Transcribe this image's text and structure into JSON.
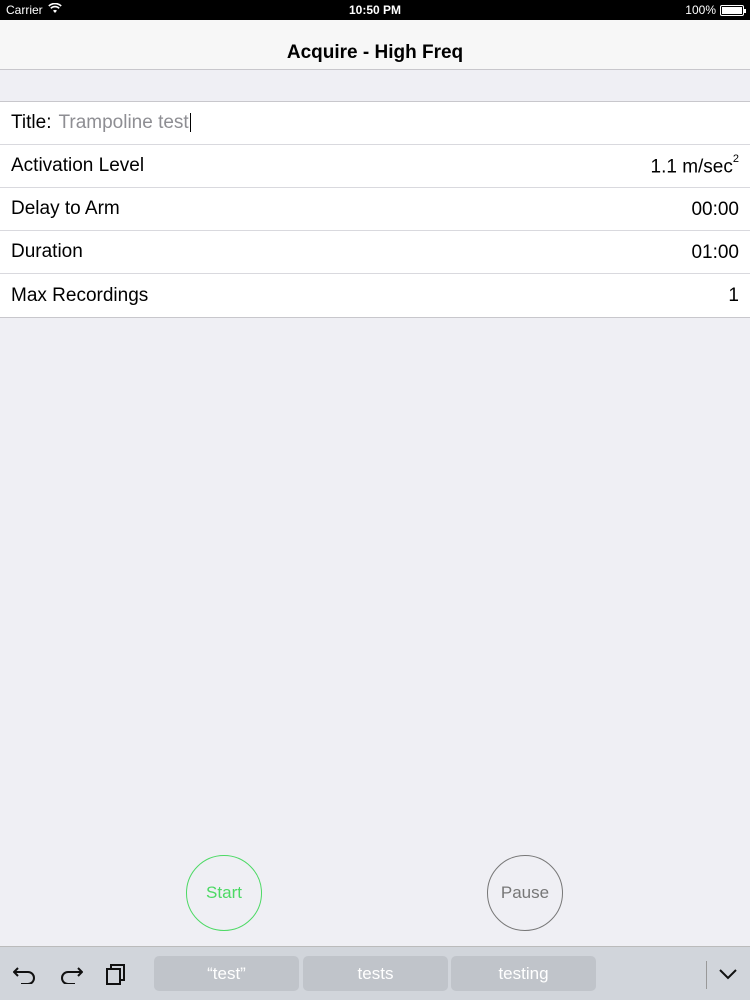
{
  "status_bar": {
    "carrier": "Carrier",
    "time": "10:50 PM",
    "battery": "100%"
  },
  "nav": {
    "title": "Acquire - High Freq"
  },
  "form": {
    "title_label": "Title:",
    "title_value": "Trampoline test",
    "rows": [
      {
        "label": "Activation Level",
        "value": "1.1  m/sec",
        "superscript": "2"
      },
      {
        "label": "Delay to Arm",
        "value": "00:00"
      },
      {
        "label": "Duration",
        "value": "01:00"
      },
      {
        "label": "Max Recordings",
        "value": "1"
      }
    ]
  },
  "buttons": {
    "start": "Start",
    "pause": "Pause"
  },
  "keyboard_bar": {
    "suggestions": [
      "“test”",
      "tests",
      "testing"
    ],
    "icons": [
      "undo-icon",
      "redo-icon",
      "paste-icon",
      "chevron-down-icon"
    ]
  },
  "colors": {
    "start_accent": "#4cd964",
    "pause_accent": "#777777"
  }
}
